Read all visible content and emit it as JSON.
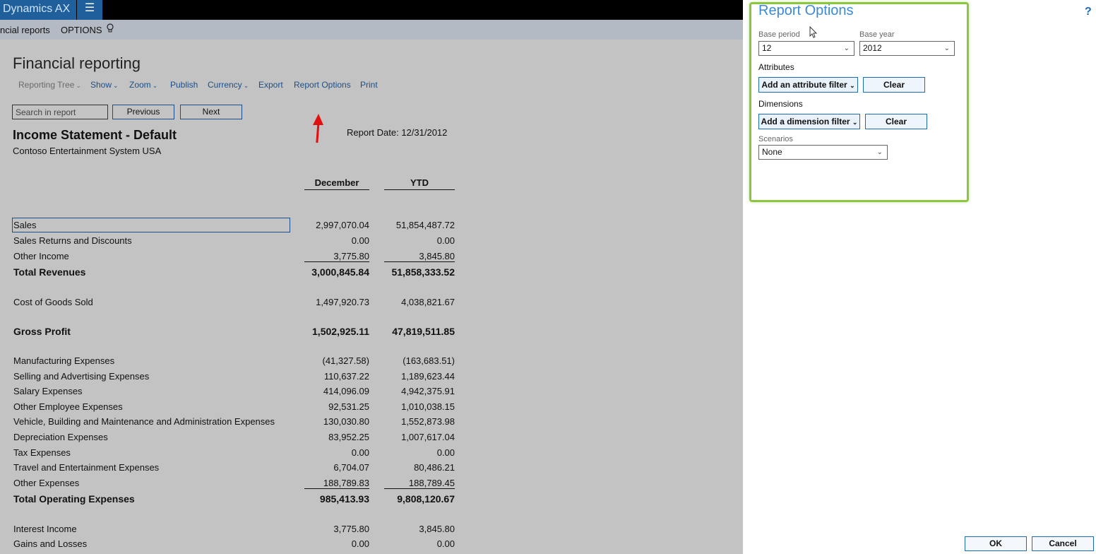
{
  "app": {
    "brand": "Dynamics AX",
    "menu_icon": "hamburger-icon"
  },
  "subbar": {
    "breadcrumb": "ncial reports",
    "options": "OPTIONS",
    "lightbulb_icon": "lightbulb-icon"
  },
  "page": {
    "title": "Financial reporting"
  },
  "actions": {
    "reporting_tree": "Reporting Tree",
    "show": "Show",
    "zoom": "Zoom",
    "publish": "Publish",
    "currency": "Currency",
    "export": "Export",
    "report_options": "Report Options",
    "print": "Print"
  },
  "search": {
    "placeholder": "Search in report",
    "previous": "Previous",
    "next": "Next"
  },
  "report": {
    "title": "Income Statement - Default",
    "company": "Contoso Entertainment System USA",
    "date": "Report Date: 12/31/2012",
    "col1": "December",
    "col2": "YTD",
    "rows": [
      {
        "label": "Sales",
        "v1": "2,997,070.04",
        "v2": "51,854,487.72"
      },
      {
        "label": "Sales Returns and Discounts",
        "v1": "0.00",
        "v2": "0.00"
      },
      {
        "label": "Other Income",
        "v1": "3,775.80",
        "v2": "3,845.80"
      },
      {
        "label": "Total Revenues",
        "v1": "3,000,845.84",
        "v2": "51,858,333.52"
      },
      {
        "label": "Cost of Goods Sold",
        "v1": "1,497,920.73",
        "v2": "4,038,821.67"
      },
      {
        "label": "Gross Profit",
        "v1": "1,502,925.11",
        "v2": "47,819,511.85"
      },
      {
        "label": "Manufacturing Expenses",
        "v1": "(41,327.58)",
        "v2": "(163,683.51)"
      },
      {
        "label": "Selling and Advertising Expenses",
        "v1": "110,637.22",
        "v2": "1,189,623.44"
      },
      {
        "label": "Salary Expenses",
        "v1": "414,096.09",
        "v2": "4,942,375.91"
      },
      {
        "label": "Other Employee Expenses",
        "v1": "92,531.25",
        "v2": "1,010,038.15"
      },
      {
        "label": "Vehicle, Building and Maintenance and Administration Expenses",
        "v1": "130,030.80",
        "v2": "1,552,873.98"
      },
      {
        "label": "Depreciation Expenses",
        "v1": "83,952.25",
        "v2": "1,007,617.04"
      },
      {
        "label": "Tax Expenses",
        "v1": "0.00",
        "v2": "0.00"
      },
      {
        "label": "Travel and Entertainment Expenses",
        "v1": "6,704.07",
        "v2": "80,486.21"
      },
      {
        "label": "Other Expenses",
        "v1": "188,789.83",
        "v2": "188,789.45"
      },
      {
        "label": "Total Operating Expenses",
        "v1": "985,413.93",
        "v2": "9,808,120.67"
      },
      {
        "label": "Interest Income",
        "v1": "3,775.80",
        "v2": "3,845.80"
      },
      {
        "label": "Gains and Losses",
        "v1": "0.00",
        "v2": "0.00"
      }
    ]
  },
  "panel": {
    "title": "Report Options",
    "help": "?",
    "base_period_label": "Base period",
    "base_period_value": "12",
    "base_year_label": "Base year",
    "base_year_value": "2012",
    "attributes_label": "Attributes",
    "add_attribute": "Add an attribute filter",
    "clear": "Clear",
    "dimensions_label": "Dimensions",
    "add_dimension": "Add a dimension filter",
    "scenarios_label": "Scenarios",
    "scenarios_value": "None",
    "ok": "OK",
    "cancel": "Cancel"
  },
  "colors": {
    "accent": "#1f5f9c",
    "highlight": "#8cc63f",
    "arrow": "#e01010",
    "title_blue": "#3a8ad6"
  }
}
